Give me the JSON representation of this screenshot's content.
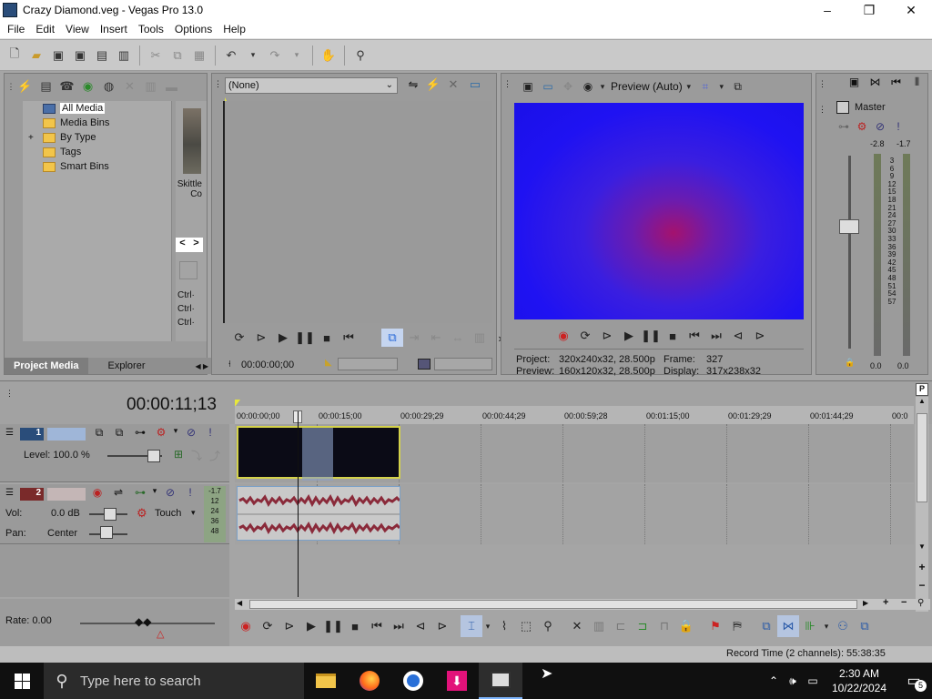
{
  "window": {
    "title": "Crazy Diamond.veg - Vegas Pro 13.0",
    "min": "–",
    "max": "❐",
    "close": "✕"
  },
  "menu": [
    "File",
    "Edit",
    "View",
    "Insert",
    "Tools",
    "Options",
    "Help"
  ],
  "project_media": {
    "tree": [
      {
        "label": "All Media",
        "selected": true
      },
      {
        "label": "Media Bins"
      },
      {
        "label": "By Type",
        "expandable": true,
        "expander": "+"
      },
      {
        "label": "Tags"
      },
      {
        "label": "Smart Bins"
      }
    ],
    "thumb_caption": "Skittle\nCo",
    "nav_prev": "<",
    "nav_next": ">",
    "ctrl_hints": [
      "Ctrl·",
      "Ctrl·",
      "Ctrl·"
    ],
    "tabs": [
      "Project Media",
      "Explorer"
    ],
    "tab_arrows": "◀ ▶"
  },
  "trimmer": {
    "dropdown": "(None)",
    "timecode": "00:00:00;00"
  },
  "preview": {
    "mode": "Preview (Auto)",
    "project_label": "Project:",
    "project_value": "320x240x32, 28.500p",
    "preview_label": "Preview:",
    "preview_value": "160x120x32, 28.500p",
    "frame_label": "Frame:",
    "frame_value": "327",
    "display_label": "Display:",
    "display_value": "317x238x32"
  },
  "master": {
    "title": "Master",
    "peak_left": "-2.8",
    "peak_right": "-1.7",
    "scale": [
      "3",
      "6",
      "9",
      "12",
      "15",
      "18",
      "21",
      "24",
      "27",
      "30",
      "33",
      "36",
      "39",
      "42",
      "45",
      "48",
      "51",
      "54",
      "57"
    ],
    "bottom_left": "0.0",
    "bottom_right": "0.0"
  },
  "timeline": {
    "cursor_time": "00:00:11;13",
    "ruler": [
      "00:00:00;00",
      "00:00:15;00",
      "00:00:29;29",
      "00:00:44;29",
      "00:00:59;28",
      "00:01:15;00",
      "00:01:29;29",
      "00:01:44;29",
      "00:0"
    ],
    "video_track": {
      "number": "1",
      "level_label": "Level: 100.0 %"
    },
    "audio_track": {
      "number": "2",
      "vol_label": "Vol:",
      "vol_value": "0.0 dB",
      "pan_label": "Pan:",
      "pan_value": "Center",
      "automation": "Touch",
      "meter_top": "-1.7",
      "meter_scale": [
        "12",
        "24",
        "36",
        "48"
      ]
    },
    "rate": "Rate: 0.00"
  },
  "status": {
    "record_time": "Record Time (2 channels): 55:38:35"
  },
  "taskbar": {
    "search_placeholder": "Type here to search",
    "time": "2:30 AM",
    "date": "10/22/2024",
    "notifications": "5"
  }
}
